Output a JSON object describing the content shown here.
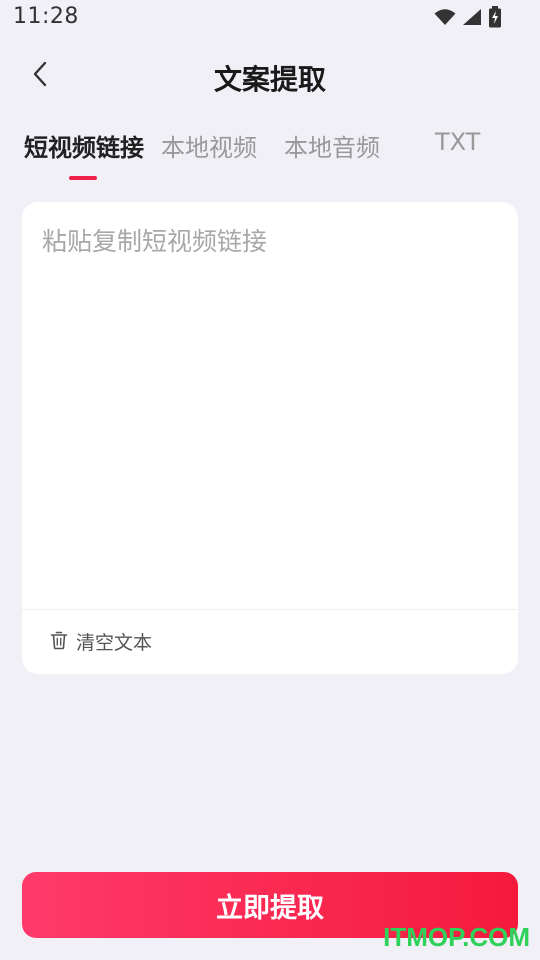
{
  "status_bar": {
    "time": "11:28"
  },
  "header": {
    "title": "文案提取"
  },
  "tabs": [
    {
      "label": "短视频链接",
      "active": true
    },
    {
      "label": "本地视频",
      "active": false
    },
    {
      "label": "本地音频",
      "active": false
    },
    {
      "label": "TXT",
      "active": false
    }
  ],
  "input": {
    "value": "",
    "placeholder": "粘贴复制短视频链接"
  },
  "clear_button": {
    "label": "清空文本"
  },
  "extract_button": {
    "label": "立即提取"
  },
  "watermark": {
    "text": "ITMOP.COM"
  },
  "colors": {
    "accent": "#f0204a",
    "background": "#f0f0f6",
    "watermark": "#2fd15a"
  }
}
